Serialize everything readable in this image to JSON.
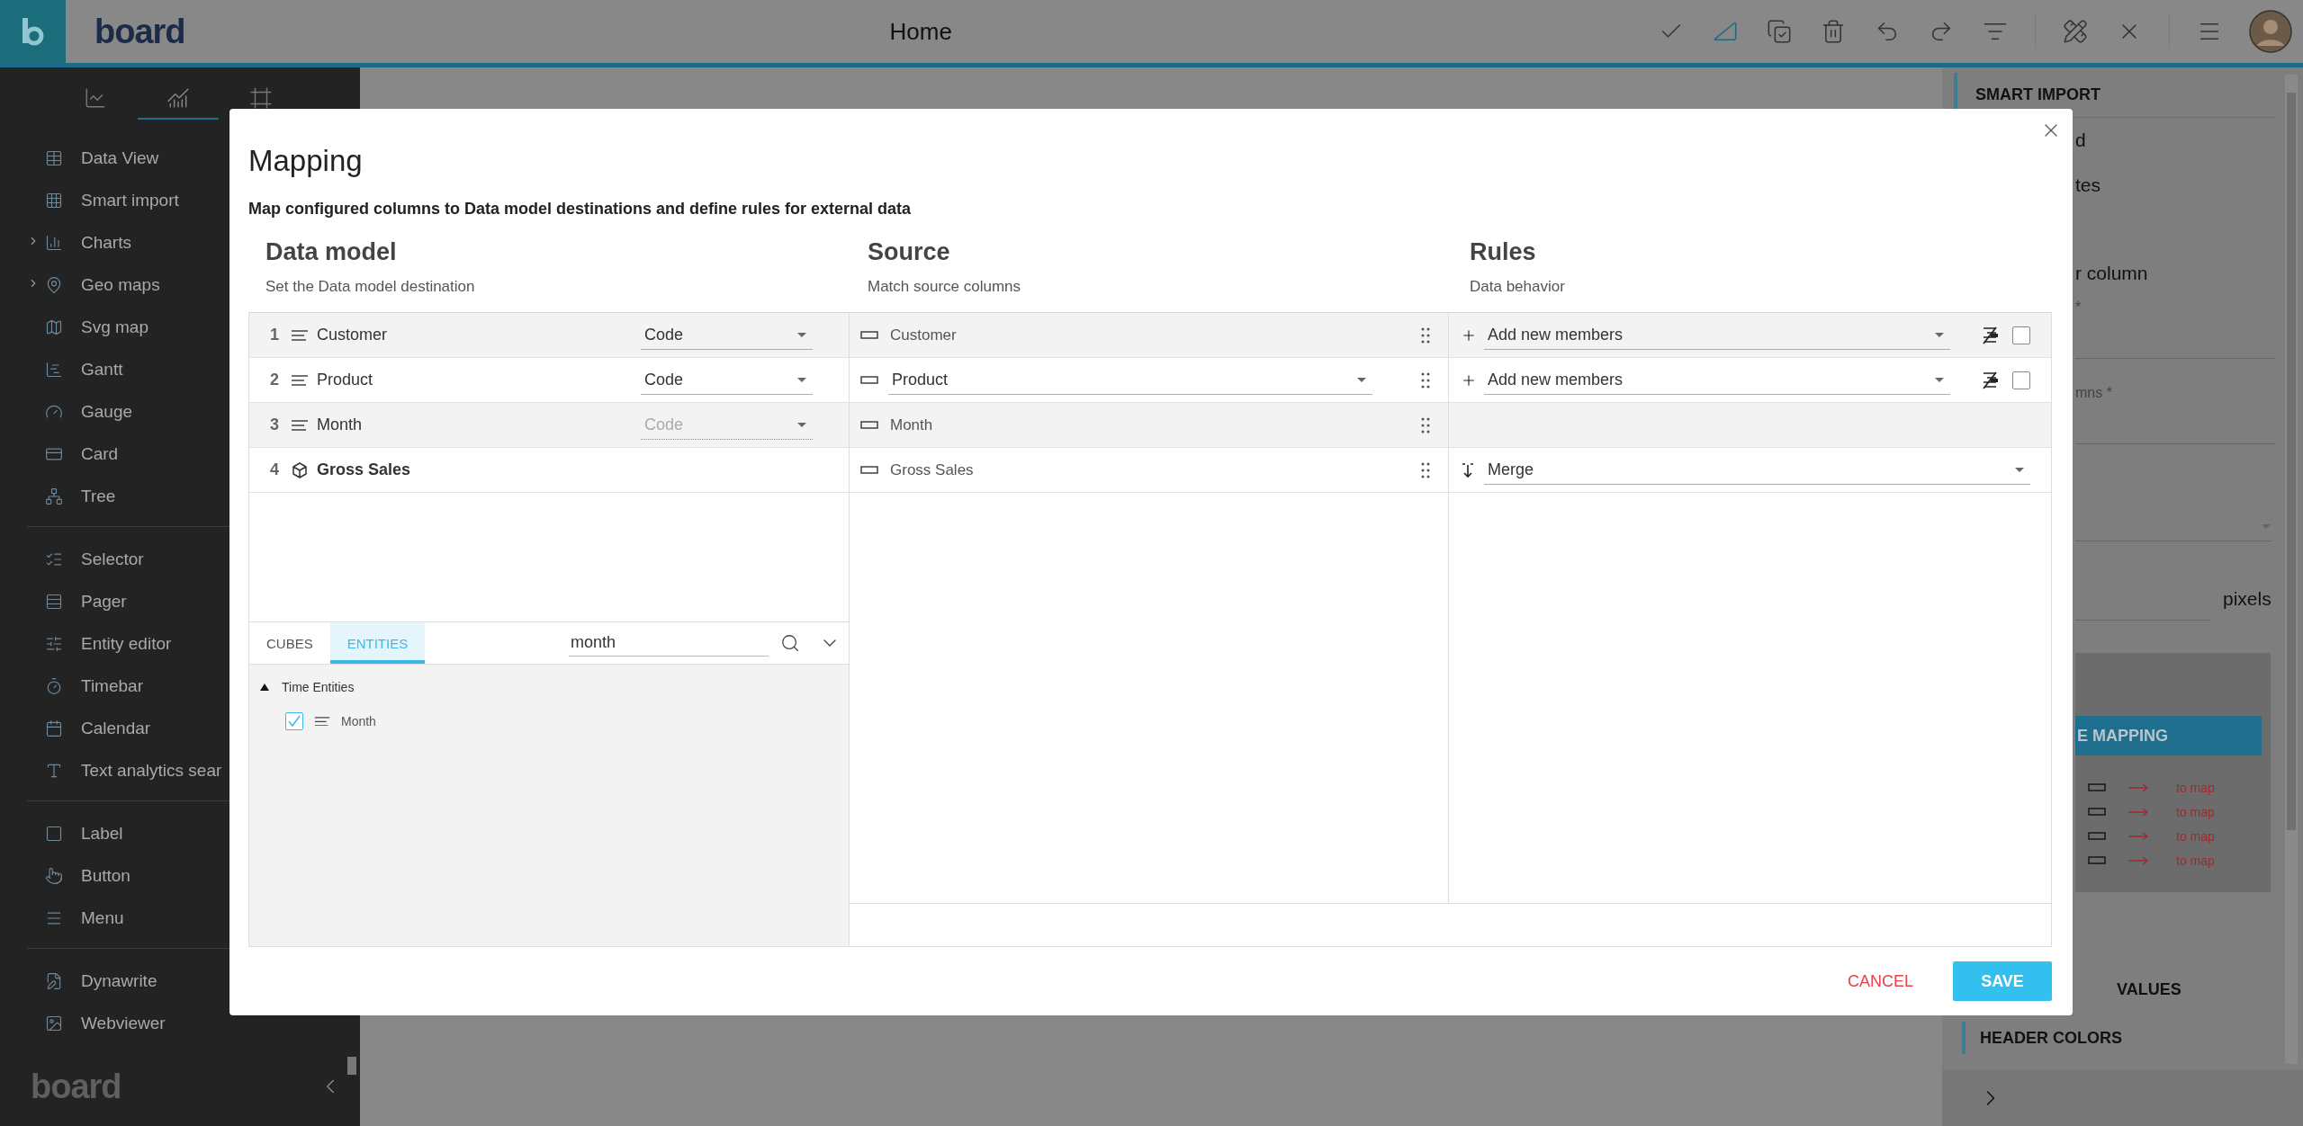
{
  "top_bar": {
    "logo": "board",
    "title": "Home",
    "toolbar": [
      {
        "selected": false
      },
      {
        "selected": true
      },
      {
        "selected": false
      },
      {
        "selected": false
      },
      {
        "selected": false
      },
      {
        "selected": false
      },
      {
        "selected": false
      },
      {
        "selected": false
      },
      {
        "selected": false
      },
      {
        "selected": false
      }
    ]
  },
  "sidebar": {
    "tabs": [
      {
        "selected": false
      },
      {
        "selected": true
      },
      {
        "selected": false
      }
    ],
    "sections": [
      {
        "items": [
          {
            "label": "Data View",
            "expandable": false
          },
          {
            "label": "Smart import",
            "expandable": false
          },
          {
            "label": "Charts",
            "expandable": true
          },
          {
            "label": "Geo maps",
            "expandable": true
          },
          {
            "label": "Svg map",
            "expandable": false
          },
          {
            "label": "Gantt",
            "expandable": false
          },
          {
            "label": "Gauge",
            "expandable": false
          },
          {
            "label": "Card",
            "expandable": false
          },
          {
            "label": "Tree",
            "expandable": false
          }
        ]
      },
      {
        "items": [
          {
            "label": "Selector",
            "expandable": false
          },
          {
            "label": "Pager",
            "expandable": false
          },
          {
            "label": "Entity editor",
            "expandable": false
          },
          {
            "label": "Timebar",
            "expandable": false
          },
          {
            "label": "Calendar",
            "expandable": false
          },
          {
            "label": "Text analytics sear",
            "expandable": false
          }
        ]
      },
      {
        "items": [
          {
            "label": "Label",
            "expandable": false
          },
          {
            "label": "Button",
            "expandable": false
          },
          {
            "label": "Menu",
            "expandable": false
          }
        ]
      },
      {
        "items": [
          {
            "label": "Dynawrite",
            "expandable": false
          },
          {
            "label": "Webviewer",
            "expandable": false
          }
        ]
      }
    ],
    "footer_logo": "board"
  },
  "modal": {
    "title": "Mapping",
    "description": "Map configured columns to Data model destinations and define rules for external data",
    "columns": [
      {
        "title": "Data model",
        "subtitle": "Set the Data model destination"
      },
      {
        "title": "Source",
        "subtitle": "Match source columns"
      },
      {
        "title": "Rules",
        "subtitle": "Data behavior"
      }
    ],
    "rows": [
      {
        "number": "1",
        "kind": "entity",
        "name": "Customer",
        "code": {
          "value": "Code",
          "disabled": false
        },
        "source": {
          "name": "Customer",
          "dropdown": false
        },
        "rule": {
          "kind": "add",
          "value": "Add new members",
          "checked": false
        }
      },
      {
        "number": "2",
        "kind": "entity",
        "name": "Product",
        "code": {
          "value": "Code",
          "disabled": false
        },
        "source": {
          "name": "Product",
          "dropdown": true
        },
        "rule": {
          "kind": "add",
          "value": "Add new members",
          "checked": false
        }
      },
      {
        "number": "3",
        "kind": "entity",
        "name": "Month",
        "code": {
          "value": "Code",
          "disabled": true
        },
        "source": {
          "name": "Month",
          "dropdown": false
        }
      },
      {
        "number": "4",
        "kind": "cube",
        "name": "Gross Sales",
        "source": {
          "name": "Gross Sales",
          "dropdown": false
        },
        "rule": {
          "kind": "merge",
          "value": "Merge"
        }
      }
    ],
    "browser": {
      "tabs": [
        {
          "label": "CUBES",
          "selected": false
        },
        {
          "label": "ENTITIES",
          "selected": true
        }
      ],
      "search": {
        "value": "month"
      },
      "tree": [
        {
          "label": "Time Entities",
          "expanded": true,
          "children": [
            {
              "label": "Month",
              "checked": true
            }
          ]
        }
      ]
    },
    "buttons": {
      "cancel": "CANCEL",
      "save": "SAVE"
    }
  },
  "right_panel": {
    "title": "SMART IMPORT",
    "items": [
      {
        "kind": "text",
        "text": "d"
      },
      {
        "kind": "text",
        "text": "tes"
      },
      {
        "kind": "text",
        "text": "r column"
      },
      {
        "kind": "field",
        "label": "*"
      },
      {
        "kind": "field",
        "label": "mns *"
      },
      {
        "kind": "select"
      },
      {
        "kind": "size",
        "unit": "pixels"
      }
    ],
    "mapping": {
      "button": "E MAPPING",
      "rows": [
        {
          "status": "to map"
        },
        {
          "status": "to map"
        },
        {
          "status": "to map"
        },
        {
          "status": "to map"
        }
      ]
    },
    "sections": [
      {
        "title": "VALUES",
        "accent": false
      },
      {
        "title": "HEADER COLORS",
        "accent": true
      }
    ]
  }
}
